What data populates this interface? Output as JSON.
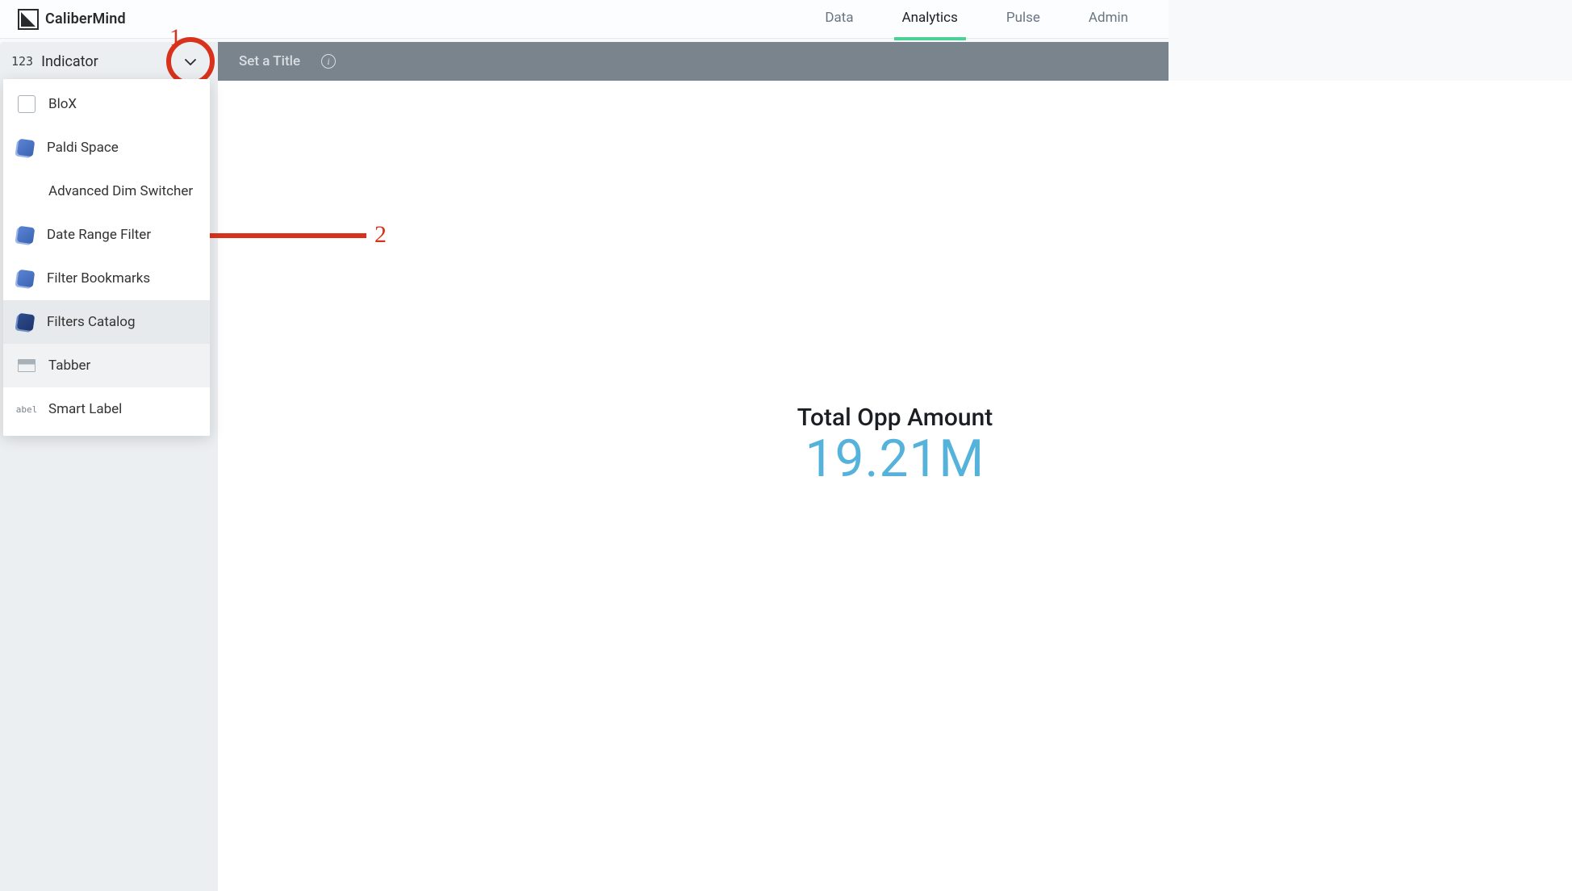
{
  "brand": {
    "name": "CaliberMind"
  },
  "topnav": {
    "items": [
      {
        "label": "Data",
        "active": false
      },
      {
        "label": "Analytics",
        "active": true
      },
      {
        "label": "Pulse",
        "active": false
      },
      {
        "label": "Admin",
        "active": false
      }
    ]
  },
  "toolbar": {
    "prefix": "123",
    "current": "Indicator",
    "set_title": "Set a Title"
  },
  "dropdown": {
    "items": [
      {
        "label": "BloX",
        "icon": "blox-icon"
      },
      {
        "label": "Paldi Space",
        "icon": "widget-icon"
      },
      {
        "label": "Advanced Dim Switcher",
        "icon": "none"
      },
      {
        "label": "Date Range Filter",
        "icon": "widget-icon"
      },
      {
        "label": "Filter Bookmarks",
        "icon": "widget-icon"
      },
      {
        "label": "Filters Catalog",
        "icon": "widget-icon-dark",
        "selected": true
      },
      {
        "label": "Tabber",
        "icon": "tabber-icon"
      },
      {
        "label": "Smart Label",
        "icon": "label-icon"
      }
    ]
  },
  "kpi": {
    "title": "Total Opp Amount",
    "value": "19.21M"
  },
  "annotations": {
    "step1": "1",
    "step2": "2"
  },
  "colors": {
    "accent_green": "#4ad295",
    "kpi_blue": "#55b3db",
    "annotation_red": "#d8321c",
    "toolbar_bg": "#7a848c"
  }
}
